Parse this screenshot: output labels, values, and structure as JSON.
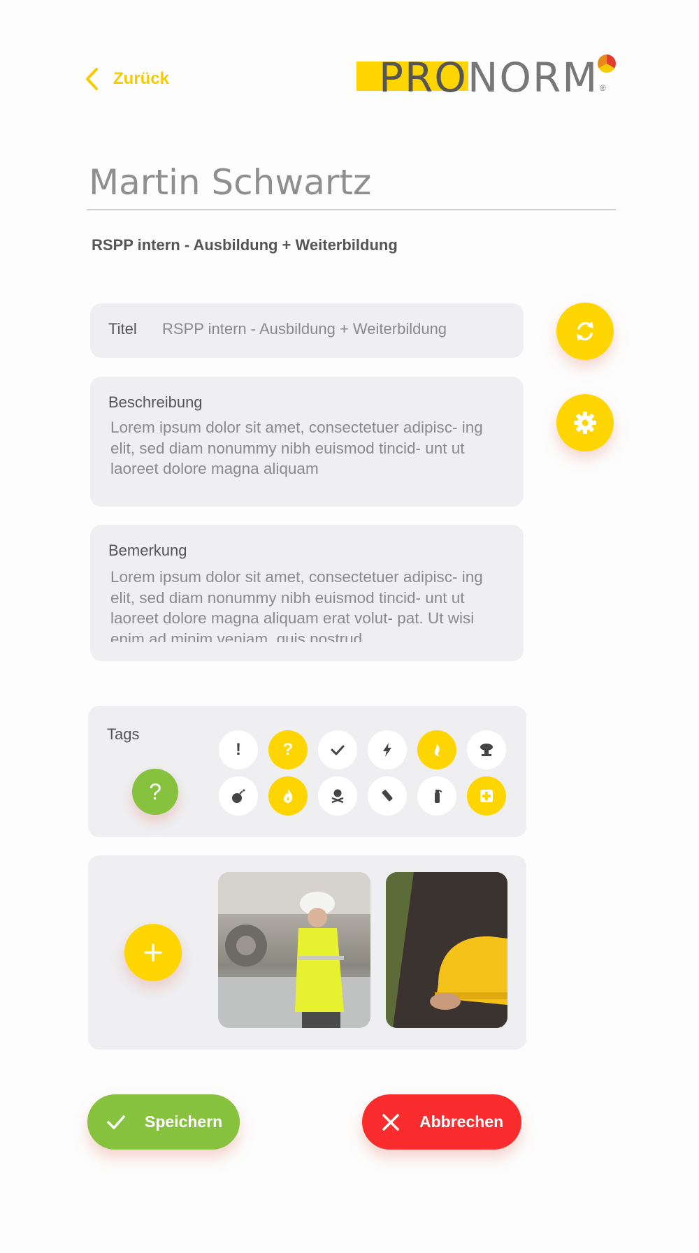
{
  "header": {
    "back_label": "Zurück",
    "logo_text_pro": "PRO",
    "logo_text_norm": "NORM",
    "logo_reg": "®"
  },
  "person": {
    "name": "Martin Schwartz",
    "subtitle": "RSPP intern - Ausbildung + Weiterbildung"
  },
  "form": {
    "titel_label": "Titel",
    "titel_value": "RSPP intern - Ausbildung + Weiterbildung",
    "beschreibung_label": "Beschreibung",
    "beschreibung_text": "Lorem ipsum dolor sit amet, consectetuer adipisc- ing elit, sed diam nonummy nibh euismod tincid- unt ut laoreet dolore magna aliquam",
    "bemerkung_label": "Bemerkung",
    "bemerkung_text": "Lorem ipsum dolor sit amet, consectetuer adipisc- ing elit, sed diam nonummy nibh euismod tincid- unt ut laoreet dolore magna aliquam erat volut- pat. Ut wisi enim ad minim veniam, quis nostrud"
  },
  "tags": {
    "label": "Tags",
    "current_glyph": "?",
    "items": [
      {
        "icon": "exclamation-icon",
        "glyph": "!",
        "active": false
      },
      {
        "icon": "question-icon",
        "glyph": "?",
        "active": true
      },
      {
        "icon": "check-icon",
        "glyph": "",
        "active": false
      },
      {
        "icon": "lightning-icon",
        "glyph": "",
        "active": false
      },
      {
        "icon": "flame-leaf-icon",
        "glyph": "",
        "active": true
      },
      {
        "icon": "explosion-icon",
        "glyph": "",
        "active": false
      },
      {
        "icon": "bomb-icon",
        "glyph": "",
        "active": false
      },
      {
        "icon": "fire-icon",
        "glyph": "",
        "active": true
      },
      {
        "icon": "skull-crossbones-icon",
        "glyph": "",
        "active": false
      },
      {
        "icon": "flashlight-icon",
        "glyph": "",
        "active": false
      },
      {
        "icon": "fire-extinguisher-icon",
        "glyph": "",
        "active": false
      },
      {
        "icon": "first-aid-icon",
        "glyph": "",
        "active": true
      }
    ]
  },
  "actions": {
    "save_label": "Speichern",
    "cancel_label": "Abbrechen"
  },
  "colors": {
    "accent": "#ffd500",
    "green": "#86c23e",
    "red": "#fb2c2e",
    "card": "#efeff2"
  }
}
